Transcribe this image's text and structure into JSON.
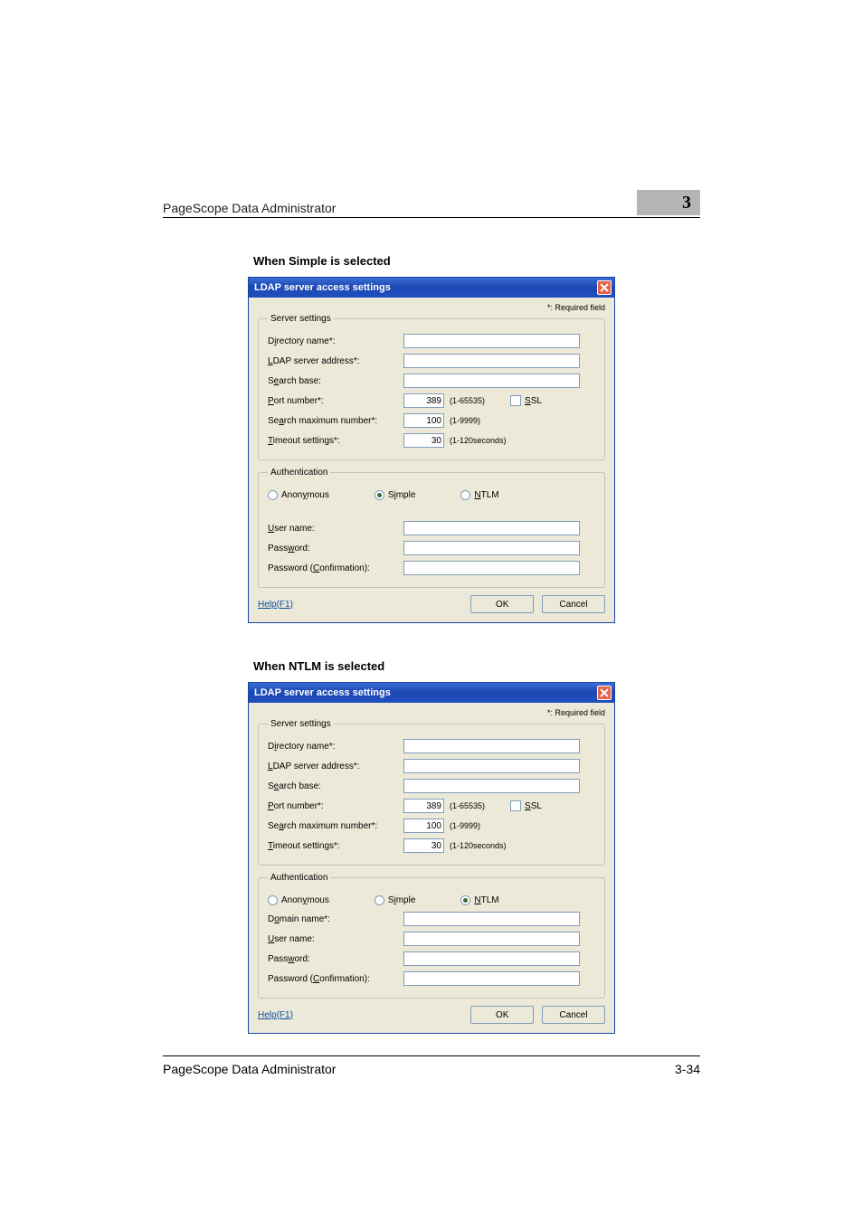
{
  "header": {
    "title": "PageScope Data Administrator",
    "chapter": "3"
  },
  "sections": {
    "simple_title": "When Simple is selected",
    "ntlm_title": "When NTLM is selected"
  },
  "dialog": {
    "title": "LDAP server access settings",
    "required_note": "*: Required field",
    "server_legend": "Server settings",
    "directory_name_pre": "D",
    "directory_name_u": "i",
    "directory_name_post": "rectory name*:",
    "ldap_u": "L",
    "ldap_post": "DAP server address*:",
    "search_base_pre": "S",
    "search_base_u": "e",
    "search_base_post": "arch base:",
    "port_u": "P",
    "port_post": "ort number*:",
    "port_value": "389",
    "port_hint": "(1-65535)",
    "ssl_u": "S",
    "ssl_post": "SL",
    "search_max_pre": "Se",
    "search_max_u": "a",
    "search_max_post": "rch maximum number*:",
    "search_max_value": "100",
    "search_max_hint": "(1-9999)",
    "timeout_u": "T",
    "timeout_post": "imeout settings*:",
    "timeout_value": "30",
    "timeout_hint": "(1-120seconds)",
    "auth_legend": "Authentication",
    "anon_pre": "Anon",
    "anon_u": "y",
    "anon_post": "mous",
    "simple_pre": "S",
    "simple_u": "i",
    "simple_post": "mple",
    "ntlm_u": "N",
    "ntlm_post": "TLM",
    "domain_pre": "D",
    "domain_u": "o",
    "domain_post": "main name*:",
    "user_u": "U",
    "user_post": "ser name:",
    "pass_pre": "Pass",
    "pass_u": "w",
    "pass_post": "ord:",
    "confirm_pre": "Password (",
    "confirm_u": "C",
    "confirm_post": "onfirmation):",
    "help": "Help(F1)",
    "ok": "OK",
    "cancel": "Cancel"
  },
  "footer": {
    "title": "PageScope Data Administrator",
    "page": "3-34"
  }
}
